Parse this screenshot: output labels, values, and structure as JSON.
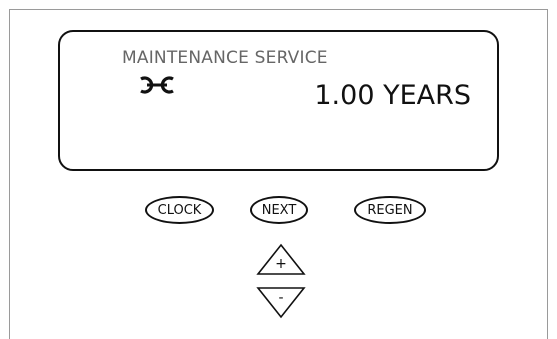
{
  "display": {
    "title": "MAINTENANCE SERVICE",
    "value": "1.00 YEARS",
    "icon": "wrench-icon"
  },
  "buttons": {
    "clock": "CLOCK",
    "next": "NEXT",
    "regen": "REGEN"
  },
  "arrows": {
    "up_label": "+",
    "down_label": "-"
  }
}
